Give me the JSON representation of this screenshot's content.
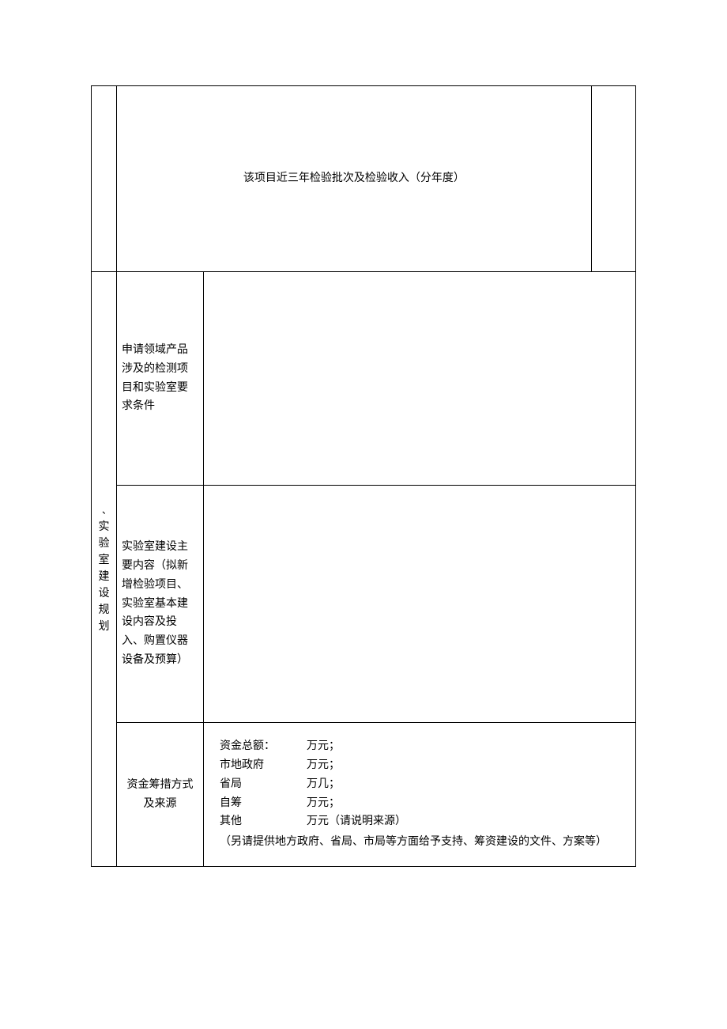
{
  "row1": {
    "header": "该项目近三年检验批次及检验收入（分年度）"
  },
  "section": {
    "dash": "、",
    "title": "实验室建设规划"
  },
  "row2": {
    "label": "申请领域产品涉及的检测项目和实验室要求条件"
  },
  "row3": {
    "label": "实验室建设主要内容（拟新增检验项目、实验室基本建设内容及投入、购置仪器设备及预算）"
  },
  "row4": {
    "label": "资金筹措方式及来源",
    "total_label": "资金总额：",
    "total_unit": "万元；",
    "gov_label": "市地政府",
    "gov_unit": "万元；",
    "prov_label": "省局",
    "prov_unit": "万几；",
    "self_label": "自筹",
    "self_unit": "万元；",
    "other_label": "其他",
    "other_unit": "万元（请说明来源）",
    "note": "（另请提供地方政府、省局、市局等方面给予支持、筹资建设的文件、方案等）"
  }
}
